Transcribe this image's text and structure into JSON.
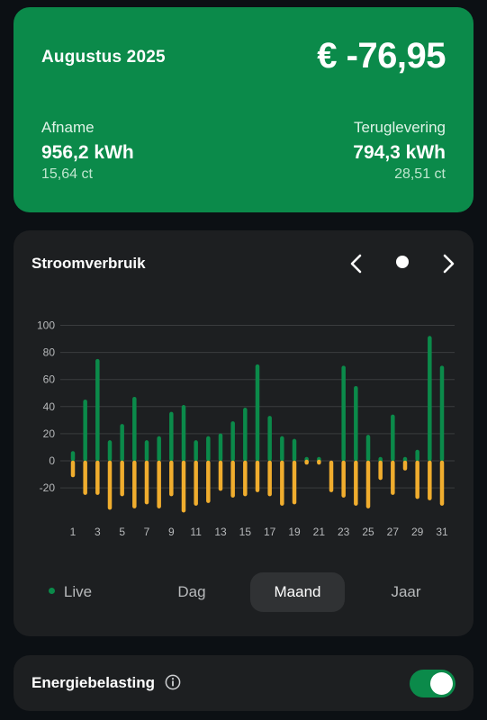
{
  "summary": {
    "month": "Augustus 2025",
    "total": "€ -76,95",
    "afname": {
      "label": "Afname",
      "value": "956,2 kWh",
      "price": "15,64 ct"
    },
    "teruglevering": {
      "label": "Teruglevering",
      "value": "794,3 kWh",
      "price": "28,51 ct"
    }
  },
  "chart_card": {
    "title": "Stroomverbruik",
    "prev_icon": "chevron-left-icon",
    "next_icon": "chevron-right-icon"
  },
  "chart_data": {
    "type": "bar",
    "x": [
      1,
      2,
      3,
      4,
      5,
      6,
      7,
      8,
      9,
      10,
      11,
      12,
      13,
      14,
      15,
      16,
      17,
      18,
      19,
      20,
      21,
      22,
      23,
      24,
      25,
      26,
      27,
      28,
      29,
      30,
      31
    ],
    "x_tick_labels": [
      "1",
      "3",
      "5",
      "7",
      "9",
      "11",
      "13",
      "15",
      "17",
      "19",
      "21",
      "23",
      "25",
      "27",
      "29",
      "31"
    ],
    "y_tick_labels": [
      "100",
      "80",
      "60",
      "40",
      "20",
      "0",
      "-20"
    ],
    "ylim": [
      -35,
      105
    ],
    "grid": true,
    "series": [
      {
        "values": [
          7,
          45,
          75,
          15,
          27,
          47,
          15,
          18,
          36,
          41,
          15,
          18,
          20,
          29,
          39,
          71,
          33,
          18,
          16,
          1,
          1,
          0,
          70,
          55,
          19,
          1,
          34,
          2,
          8,
          92,
          70
        ],
        "color": "#0b8a4a"
      },
      {
        "values": [
          -12,
          -25,
          -25,
          -36,
          -26,
          -35,
          -32,
          -35,
          -26,
          -38,
          -33,
          -31,
          -22,
          -27,
          -26,
          -23,
          -26,
          -33,
          -32,
          -2,
          -2,
          -23,
          -27,
          -33,
          -35,
          -14,
          -25,
          -7,
          -28,
          -29,
          -33
        ],
        "color": "#f0ad2e"
      }
    ]
  },
  "range_tabs": [
    {
      "label": "Live",
      "active": false
    },
    {
      "label": "Dag",
      "active": false
    },
    {
      "label": "Maand",
      "active": true
    },
    {
      "label": "Jaar",
      "active": false
    }
  ],
  "tax": {
    "label": "Energiebelasting",
    "info_icon": "info-icon",
    "enabled": true
  },
  "colors": {
    "brand_green": "#0b8a4a",
    "consumption": "#0b8a4a",
    "return": "#f0ad2e",
    "card": "#1d1f21",
    "background": "#0c1014"
  }
}
